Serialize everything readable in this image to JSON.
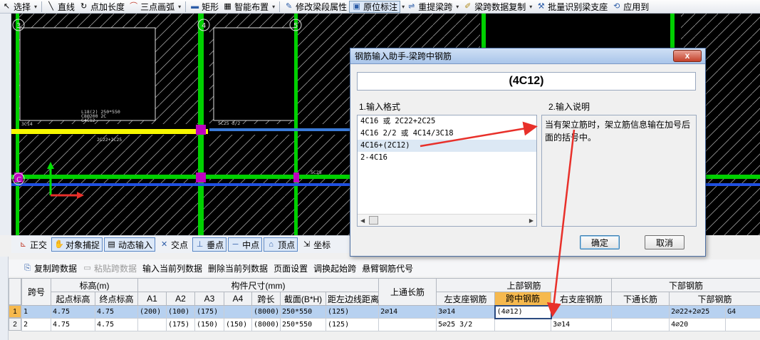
{
  "toolbar": {
    "items": [
      {
        "label": "选择",
        "icon": "cursor-icon",
        "dropdown": true
      },
      {
        "label": "直线",
        "icon": "line-icon",
        "dropdown": false
      },
      {
        "label": "点加长度",
        "icon": "point-length-icon",
        "dropdown": false
      },
      {
        "label": "三点画弧",
        "icon": "arc-icon",
        "dropdown": true
      },
      {
        "label": "矩形",
        "icon": "rectangle-icon",
        "dropdown": false
      },
      {
        "label": "智能布置",
        "icon": "smart-layout-icon",
        "dropdown": true
      },
      {
        "label": "修改梁段属性",
        "icon": "edit-beam-icon",
        "dropdown": false
      },
      {
        "label": "原位标注",
        "icon": "in-place-mark-icon",
        "dropdown": true,
        "active": true
      },
      {
        "label": "重提梁跨",
        "icon": "re-span-icon",
        "dropdown": true
      },
      {
        "label": "梁跨数据复制",
        "icon": "copy-span-icon",
        "dropdown": true
      },
      {
        "label": "批量识别梁支座",
        "icon": "batch-support-icon",
        "dropdown": false
      },
      {
        "label": "应用到",
        "icon": "apply-icon",
        "dropdown": false
      }
    ]
  },
  "canvas": {
    "axis_labels": [
      "3",
      "4",
      "5",
      "C"
    ],
    "annotations": [
      "3C14",
      "L18(2) 250*550",
      "C8@200 2C",
      "G4C12",
      "2C22+2C25",
      "5C25 3/2",
      "5C25"
    ]
  },
  "snapbar": {
    "items": [
      {
        "label": "正交",
        "icon": "ortho-icon",
        "on": false
      },
      {
        "label": "对象捕捉",
        "icon": "object-snap-icon",
        "on": true
      },
      {
        "label": "动态输入",
        "icon": "dynamic-input-icon",
        "on": true
      },
      {
        "label": "交点",
        "icon": "intersection-icon",
        "on": false
      },
      {
        "label": "垂点",
        "icon": "perpendicular-icon",
        "on": true
      },
      {
        "label": "中点",
        "icon": "midpoint-icon",
        "on": true
      },
      {
        "label": "顶点",
        "icon": "vertex-icon",
        "on": true
      },
      {
        "label": "坐标",
        "icon": "coordinate-icon",
        "on": false
      }
    ]
  },
  "dialog": {
    "title": "钢筋输入助手-梁跨中钢筋",
    "close": "x",
    "value": "(4C12)",
    "format_label": "1.输入格式",
    "desc_label": "2.输入说明",
    "formats": [
      "4C16 或 2C22+2C25",
      "4C16 2/2 或 4C14/3C18",
      "4C16+(2C12)",
      "2-4C16"
    ],
    "selected_format": 2,
    "description": "当有架立筋时，架立筋信息输在加号后面的括号中。",
    "ok": "确定",
    "cancel": "取消"
  },
  "actions": [
    {
      "label": "复制跨数据",
      "icon": "copy-icon",
      "disabled": false
    },
    {
      "label": "粘贴跨数据",
      "icon": "paste-icon",
      "disabled": true
    },
    {
      "label": "输入当前列数据",
      "icon": "",
      "disabled": false
    },
    {
      "label": "删除当前列数据",
      "icon": "",
      "disabled": false
    },
    {
      "label": "页面设置",
      "icon": "",
      "disabled": false
    },
    {
      "label": "调换起始跨",
      "icon": "",
      "disabled": false
    },
    {
      "label": "悬臂钢筋代号",
      "icon": "",
      "disabled": false
    }
  ],
  "table": {
    "groups": {
      "span": "跨号",
      "elevation": "标高(m)",
      "size": "构件尺寸(mm)",
      "top_through": "上通长筋",
      "top_rebar": "上部钢筋",
      "bottom_rebar": "下部钢筋"
    },
    "subheaders": {
      "start_elev": "起点标高",
      "end_elev": "终点标高",
      "a1": "A1",
      "a2": "A2",
      "a3": "A3",
      "a4": "A4",
      "span_len": "跨长",
      "section": "截面(B*H)",
      "edge_dist": "距左边线距离",
      "left_support": "左支座钢筋",
      "mid_span": "跨中钢筋",
      "right_support": "右支座钢筋",
      "bottom_through": "下通长筋",
      "bottom_main": "下部钢筋"
    },
    "rows": [
      {
        "num": "1",
        "span": "1",
        "start": "4.75",
        "end": "4.75",
        "a1": "(200)",
        "a2": "(100)",
        "a3": "(175)",
        "a4": "",
        "len": "(8000)",
        "section": "250*550",
        "edge": "(125)",
        "top_through": "2⌀14",
        "left": "3⌀14",
        "mid": "(4⌀12)",
        "right": "",
        "bot_through": "",
        "bot_main": "2⌀22+2⌀25",
        "extra": "G4"
      },
      {
        "num": "2",
        "span": "2",
        "start": "4.75",
        "end": "4.75",
        "a1": "",
        "a2": "(175)",
        "a3": "(150)",
        "a4": "(150)",
        "len": "(8000)",
        "section": "250*550",
        "edge": "(125)",
        "top_through": "",
        "left": "5⌀25 3/2",
        "mid": "",
        "right": "3⌀14",
        "bot_through": "",
        "bot_main": "4⌀20",
        "extra": ""
      }
    ]
  },
  "colors": {
    "beam_yellow": "#f7f700",
    "axis_green": "#00e000",
    "column_magenta": "#c000c0",
    "arrow_red": "#e8302a",
    "highlight_orange": "#f6b94e"
  }
}
